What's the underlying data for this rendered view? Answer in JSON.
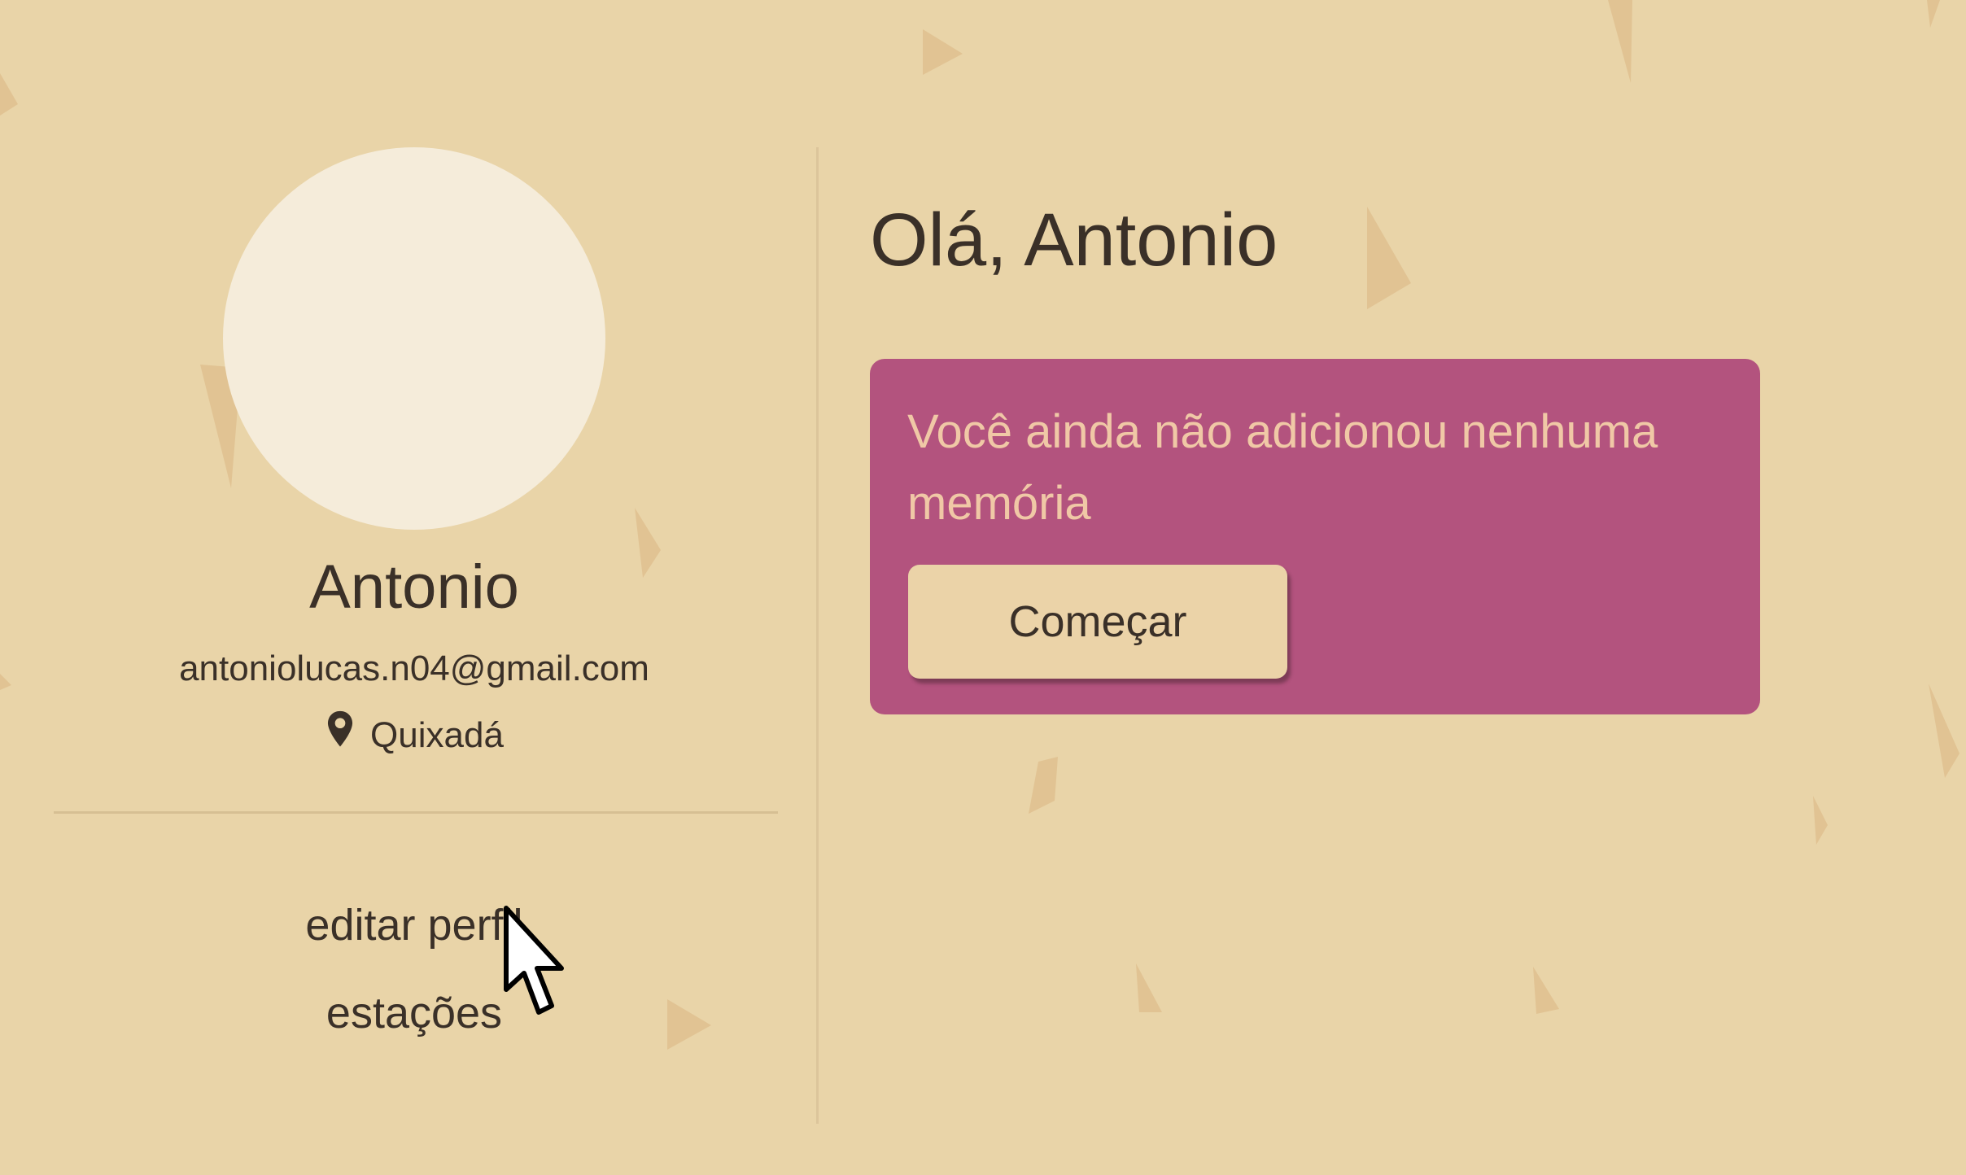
{
  "profile": {
    "name": "Antonio",
    "email": "antoniolucas.n04@gmail.com",
    "location": "Quixadá"
  },
  "menu": {
    "edit_profile": "editar perfil",
    "seasons": "estações"
  },
  "main": {
    "greeting": "Olá, Antonio",
    "empty_message": "Você ainda não adicionou nenhuma memória",
    "start_button": "Começar"
  },
  "colors": {
    "background": "#e9d4a8",
    "card": "#b3537e",
    "card_text": "#f0c8a6",
    "avatar": "#f5ecda",
    "text": "#3a3028"
  },
  "icons": {
    "location": "location-pin-icon",
    "cursor": "mouse-pointer-icon"
  }
}
